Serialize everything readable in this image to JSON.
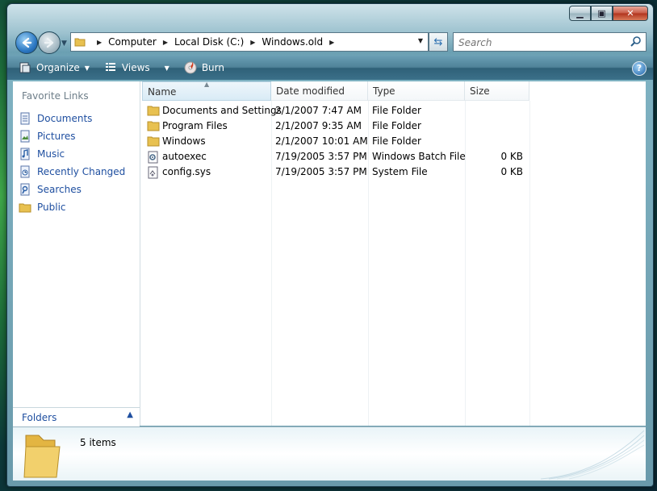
{
  "window": {
    "controls": {
      "minimize": "▁",
      "maximize": "▣",
      "close": "✕"
    }
  },
  "address": {
    "crumbs": [
      "Computer",
      "Local Disk (C:)",
      "Windows.old"
    ]
  },
  "search": {
    "placeholder": "Search"
  },
  "toolbar": {
    "organize": "Organize",
    "views": "Views",
    "burn": "Burn",
    "help": "?"
  },
  "navpane": {
    "header": "Favorite Links",
    "items": [
      {
        "label": "Documents",
        "icon": "documents-icon"
      },
      {
        "label": "Pictures",
        "icon": "pictures-icon"
      },
      {
        "label": "Music",
        "icon": "music-icon"
      },
      {
        "label": "Recently Changed",
        "icon": "recently-changed-icon"
      },
      {
        "label": "Searches",
        "icon": "searches-icon"
      },
      {
        "label": "Public",
        "icon": "folder-icon"
      }
    ],
    "folders_label": "Folders"
  },
  "columns": {
    "name": "Name",
    "date": "Date modified",
    "type": "Type",
    "size": "Size"
  },
  "files": [
    {
      "name": "Documents and Settings",
      "date": "2/1/2007 7:47 AM",
      "type": "File Folder",
      "size": "",
      "icon": "folder-icon"
    },
    {
      "name": "Program Files",
      "date": "2/1/2007 9:35 AM",
      "type": "File Folder",
      "size": "",
      "icon": "folder-icon"
    },
    {
      "name": "Windows",
      "date": "2/1/2007 10:01 AM",
      "type": "File Folder",
      "size": "",
      "icon": "folder-icon"
    },
    {
      "name": "autoexec",
      "date": "7/19/2005 3:57 PM",
      "type": "Windows Batch File",
      "size": "0 KB",
      "icon": "batch-file-icon"
    },
    {
      "name": "config.sys",
      "date": "7/19/2005 3:57 PM",
      "type": "System File",
      "size": "0 KB",
      "icon": "system-file-icon"
    }
  ],
  "details": {
    "count": "5 items"
  },
  "colors": {
    "link": "#1f4fa0",
    "toolbar": "#3b7089",
    "folder": "#e8c150"
  }
}
